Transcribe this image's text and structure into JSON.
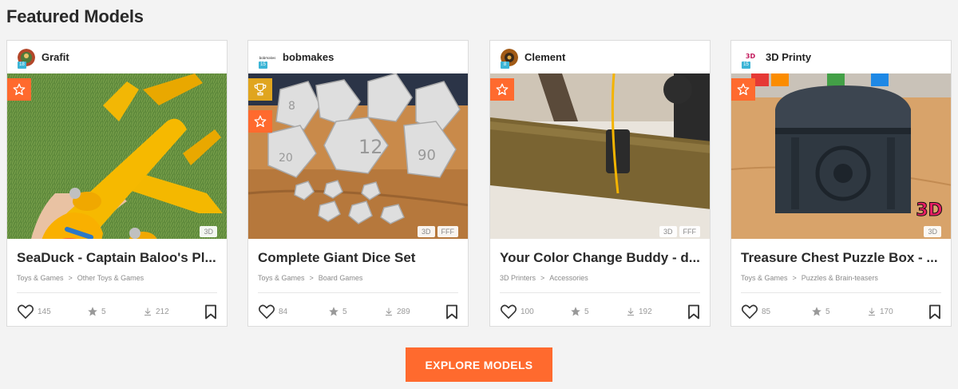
{
  "section": {
    "title": "Featured Models"
  },
  "colors": {
    "accent": "#ff6a2e",
    "trophy": "#e0a51e",
    "level_badge": "#3cb5d6"
  },
  "cards": [
    {
      "author": "Grafit",
      "level": "18",
      "badges": [
        "star-icon"
      ],
      "tags": [
        "3D"
      ],
      "title": "SeaDuck - Captain Baloo's Pl...",
      "category": "Toys & Games",
      "subcategory": "Other Toys & Games",
      "likes": "145",
      "makes": "5",
      "downloads": "212"
    },
    {
      "author": "bobmakes",
      "avatar_text": "bobmakes",
      "level": "15",
      "badges": [
        "trophy-icon",
        "star-icon"
      ],
      "tags": [
        "3D",
        "FFF"
      ],
      "title": "Complete Giant Dice Set",
      "category": "Toys & Games",
      "subcategory": "Board Games",
      "likes": "84",
      "makes": "5",
      "downloads": "289"
    },
    {
      "author": "Clement",
      "level": "8",
      "badges": [
        "star-icon"
      ],
      "tags": [
        "3D",
        "FFF"
      ],
      "title": "Your Color Change Buddy - d...",
      "category": "3D Printers",
      "subcategory": "Accessories",
      "likes": "100",
      "makes": "5",
      "downloads": "192"
    },
    {
      "author": "3D Printy",
      "avatar_text": "3D",
      "level": "15",
      "badges": [
        "star-icon"
      ],
      "tags": [
        "3D"
      ],
      "title": "Treasure Chest Puzzle Box - ...",
      "category": "Toys & Games",
      "subcategory": "Puzzles & Brain-teasers",
      "likes": "85",
      "makes": "5",
      "downloads": "170"
    }
  ],
  "breadcrumb_separator": ">",
  "explore_button": {
    "label": "EXPLORE MODELS"
  }
}
